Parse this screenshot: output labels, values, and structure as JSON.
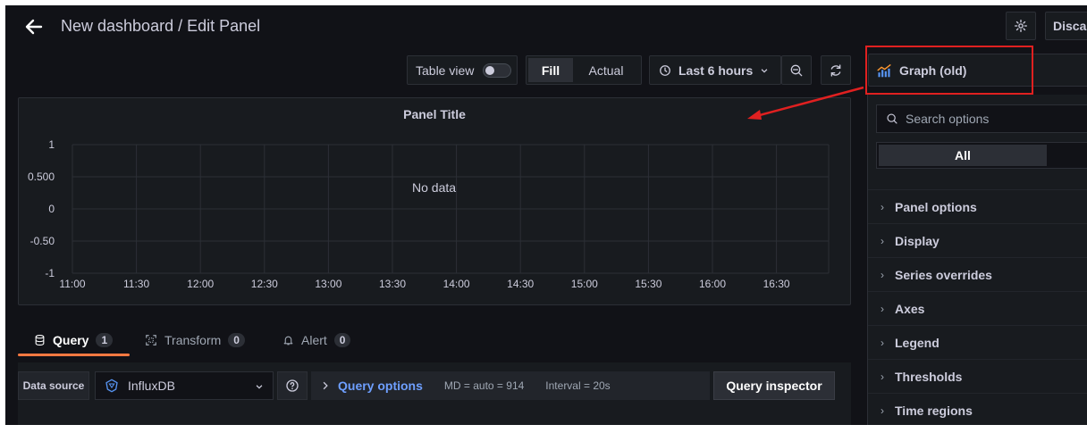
{
  "header": {
    "title": "New dashboard / Edit Panel",
    "discard_label": "Discard"
  },
  "toolbar": {
    "table_view_label": "Table view",
    "fill_label": "Fill",
    "actual_label": "Actual",
    "time_range_label": "Last 6 hours"
  },
  "visualization": {
    "label": "Graph (old)"
  },
  "panel": {
    "title": "Panel Title",
    "no_data_text": "No data"
  },
  "chart_data": {
    "type": "line",
    "x_ticks": [
      "11:00",
      "11:30",
      "12:00",
      "12:30",
      "13:00",
      "13:30",
      "14:00",
      "14:30",
      "15:00",
      "15:30",
      "16:00",
      "16:30"
    ],
    "y_ticks": [
      "1",
      "0.500",
      "0",
      "-0.50",
      "-1"
    ],
    "ylim": [
      -1,
      1
    ],
    "series": [],
    "grid": true
  },
  "query_tabs": [
    {
      "label": "Query",
      "count": "1"
    },
    {
      "label": "Transform",
      "count": "0"
    },
    {
      "label": "Alert",
      "count": "0"
    }
  ],
  "query_bar": {
    "data_source_label": "Data source",
    "data_source_value": "InfluxDB",
    "query_options_label": "Query options",
    "md_text": "MD = auto = 914",
    "interval_text": "Interval = 20s",
    "inspector_label": "Query inspector"
  },
  "sidebar": {
    "search_placeholder": "Search options",
    "filter_all_label": "All",
    "sections": [
      {
        "label": "Panel options"
      },
      {
        "label": "Display"
      },
      {
        "label": "Series overrides"
      },
      {
        "label": "Axes"
      },
      {
        "label": "Legend"
      },
      {
        "label": "Thresholds"
      },
      {
        "label": "Time regions"
      }
    ]
  },
  "colors": {
    "background": "#111217",
    "panel": "#181b1f",
    "accent_tab": "#ff7941",
    "link": "#6e9fff",
    "annotation": "#e02020"
  }
}
